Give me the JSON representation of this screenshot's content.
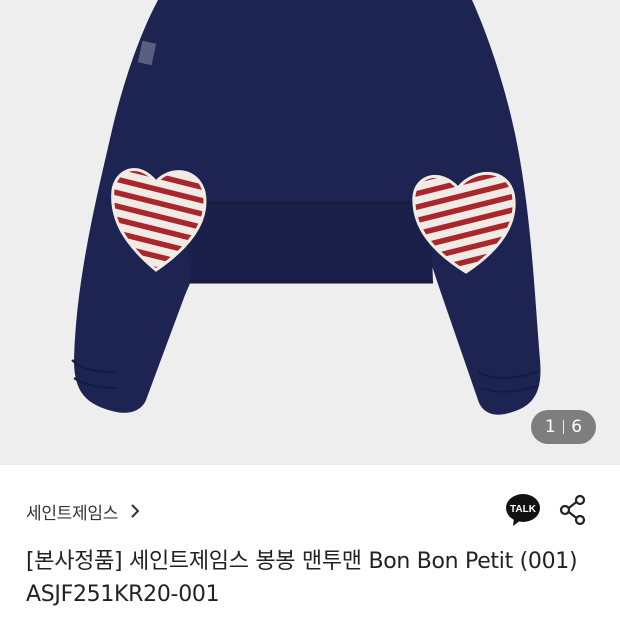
{
  "image": {
    "alt": "세인트제임스 봉봉 맨투맨 Bon Bon Petit",
    "counter_current": "1",
    "counter_total": "6",
    "colors": {
      "background": "#eeeeee",
      "garment": "#1e2452",
      "heart_stripe": "#a8262c",
      "heart_base": "#f1ebe6"
    }
  },
  "brand": {
    "name": "세인트제임스",
    "chevron_icon": "chevron-right-icon"
  },
  "actions": {
    "talk_label": "TALK",
    "talk_icon": "kakaotalk-bubble-icon",
    "share_icon": "share-icon"
  },
  "product": {
    "title": "[본사정품] 세인트제임스 봉봉 맨투맨 Bon Bon Petit (001) ASJF251KR20-001"
  }
}
